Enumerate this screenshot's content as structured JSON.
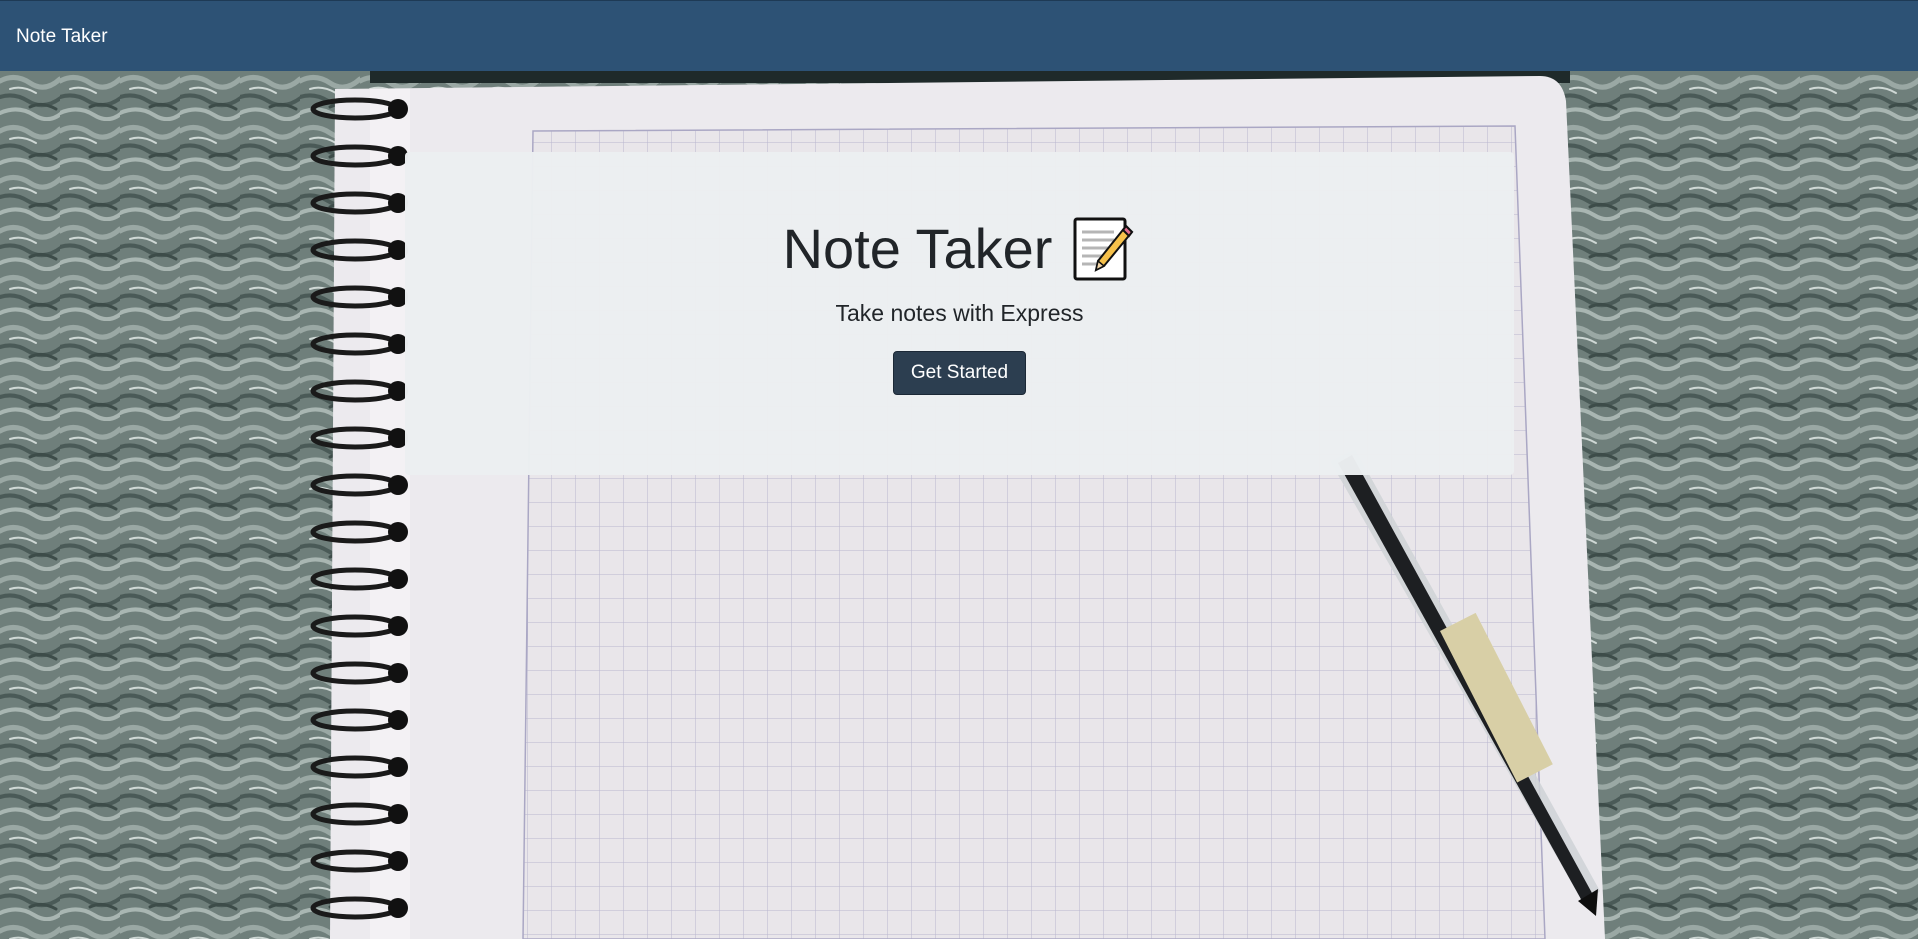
{
  "navbar": {
    "brand": "Note Taker",
    "color": "#2d5275"
  },
  "hero": {
    "title": "Note Taker",
    "title_icon": "memo-icon",
    "subtitle": "Take notes with Express",
    "button_label": "Get Started",
    "button_color": "#2c3e50"
  },
  "background": {
    "description_icon": "notebook-photo"
  }
}
